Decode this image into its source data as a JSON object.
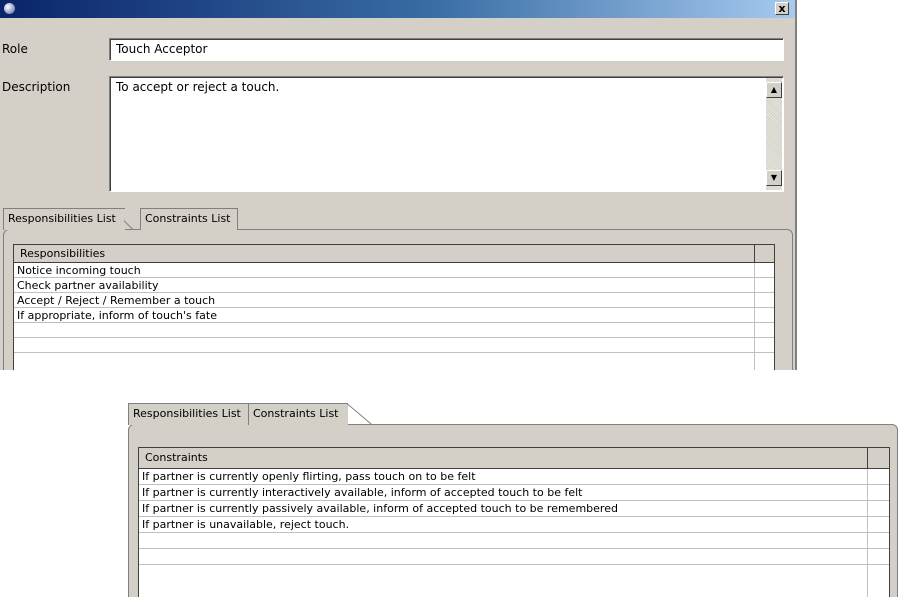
{
  "window": {
    "close_label": "x"
  },
  "role": {
    "label": "Role",
    "value": "Touch Acceptor"
  },
  "description": {
    "label": "Description",
    "value": "To accept or reject a touch."
  },
  "tabs": {
    "responsibilities_label": "Responsibilities List",
    "constraints_label": "Constraints List"
  },
  "responsibilities": {
    "header": "Responsibilities",
    "rows": [
      "Notice incoming touch",
      "Check partner availability",
      "Accept / Reject / Remember a touch",
      "If appropriate, inform of touch's fate",
      "",
      ""
    ]
  },
  "constraints": {
    "header": "Constraints",
    "rows": [
      "If partner is currently openly flirting, pass touch on to be felt",
      "If partner is currently interactively available, inform of accepted touch to be felt",
      "If partner is currently passively available, inform of accepted touch to be remembered",
      "If partner is unavailable, reject touch.",
      "",
      ""
    ]
  },
  "scroll_glyphs": {
    "up": "▲",
    "down": "▼"
  }
}
